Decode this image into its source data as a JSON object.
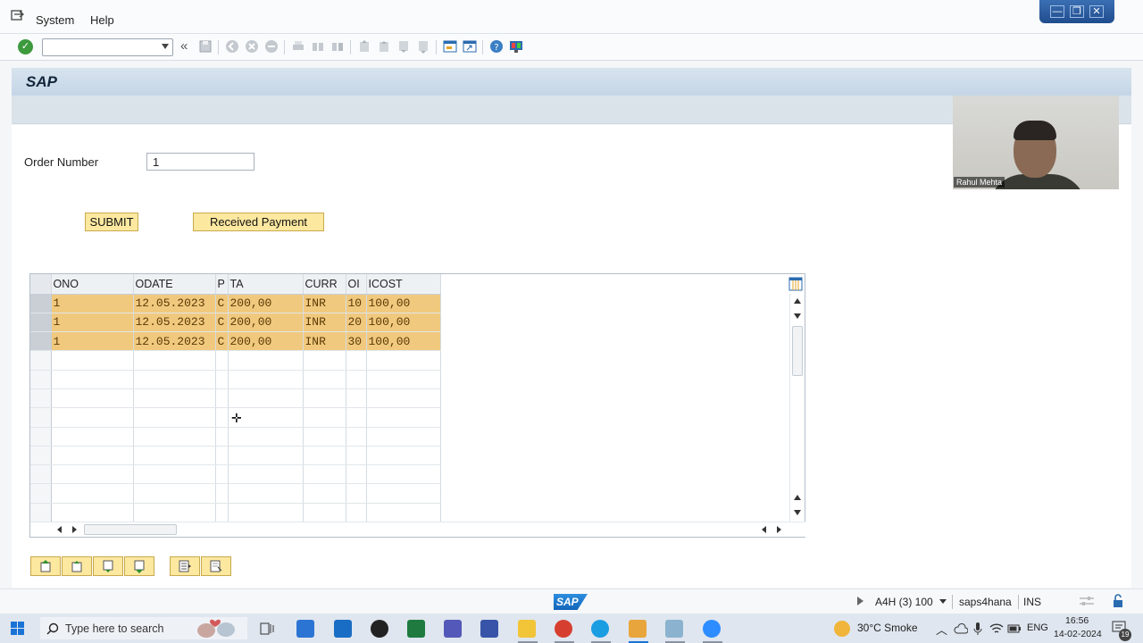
{
  "menu": {
    "system": "System",
    "help": "Help"
  },
  "window_controls": {
    "minimize": "—",
    "restore": "❐",
    "close": "✕"
  },
  "toolbar": {
    "command_field_value": "",
    "collapse": "«"
  },
  "title": "SAP",
  "form": {
    "order_number_label": "Order Number",
    "order_number_value": "1"
  },
  "buttons": {
    "submit": "SUBMIT",
    "received_payment": "Received Payment"
  },
  "grid": {
    "columns": [
      "ONO",
      "ODATE",
      "P",
      "TA",
      "CURR",
      "OI",
      "ICOST"
    ],
    "rows": [
      [
        "1",
        "12.05.2023",
        "C",
        "200,00",
        "INR",
        "10",
        "100,00"
      ],
      [
        "1",
        "12.05.2023",
        "C",
        "200,00",
        "INR",
        "20",
        "100,00"
      ],
      [
        "1",
        "12.05.2023",
        "C",
        "200,00",
        "INR",
        "30",
        "100,00"
      ]
    ],
    "empty_rows": 9
  },
  "webcam": {
    "participant_name": "Rahul Mehta"
  },
  "statusbar": {
    "system": "A4H (3) 100",
    "server": "saps4hana",
    "mode": "INS",
    "logo": "SAP"
  },
  "taskbar": {
    "search_placeholder": "Type here to search",
    "weather": "30°C Smoke",
    "language": "ENG",
    "time": "16:56",
    "date": "14-02-2024",
    "notification_count": "19"
  },
  "colors": {
    "row_highlight": "#f1c97e",
    "button_yellow": "#fde8a0",
    "title_bar": "#c4d5e6",
    "accent_blue": "#1a73d6"
  }
}
